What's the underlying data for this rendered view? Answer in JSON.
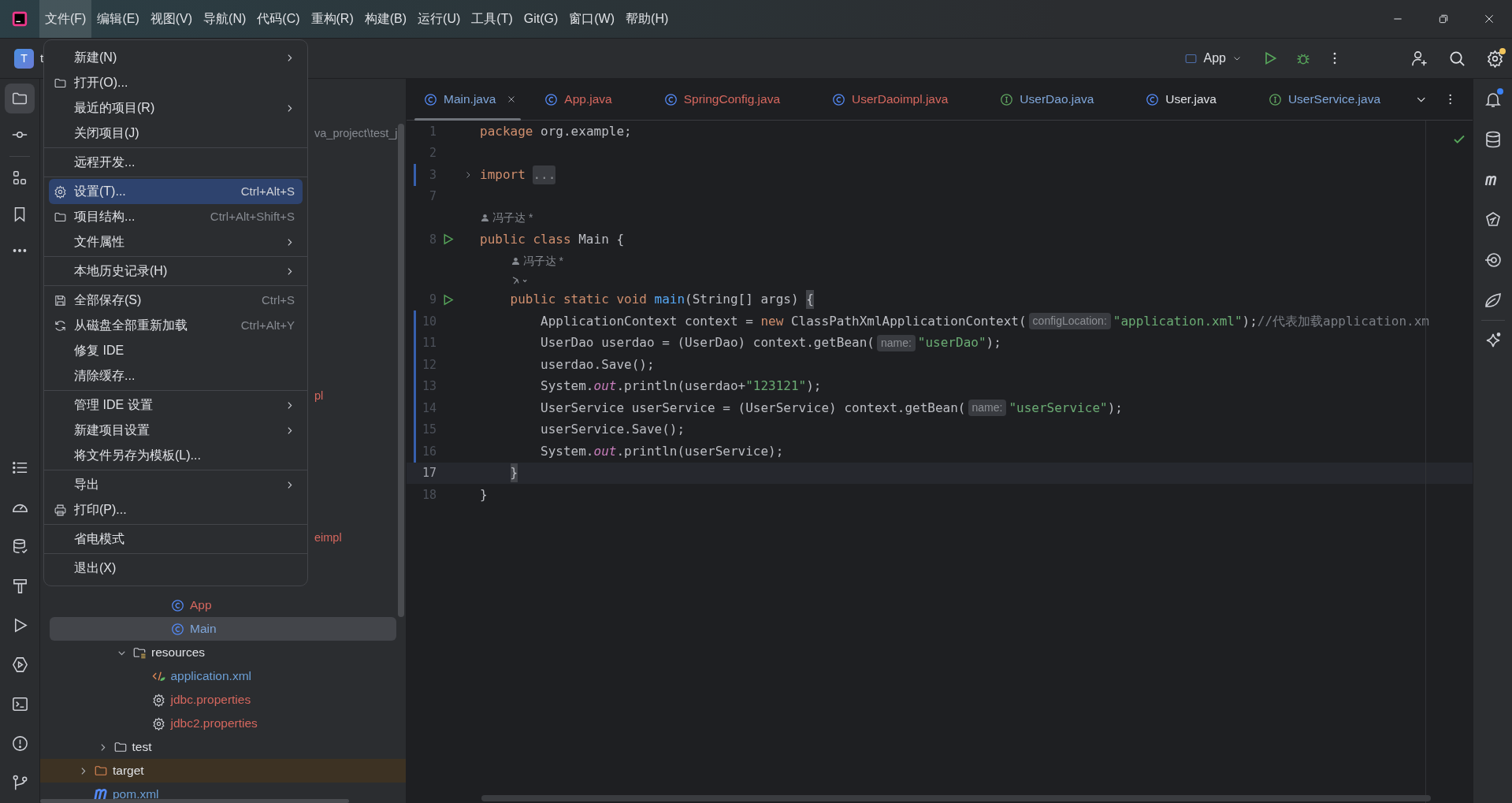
{
  "menu_bar": [
    {
      "label": "文件(F)",
      "selected": true
    },
    {
      "label": "编辑(E)",
      "selected": false
    },
    {
      "label": "视图(V)",
      "selected": false
    },
    {
      "label": "导航(N)",
      "selected": false
    },
    {
      "label": "代码(C)",
      "selected": false
    },
    {
      "label": "重构(R)",
      "selected": false
    },
    {
      "label": "构建(B)",
      "selected": false
    },
    {
      "label": "运行(U)",
      "selected": false
    },
    {
      "label": "工具(T)",
      "selected": false
    },
    {
      "label": "Git(G)",
      "selected": false
    },
    {
      "label": "窗口(W)",
      "selected": false
    },
    {
      "label": "帮助(H)",
      "selected": false
    }
  ],
  "toolbar": {
    "project_initial": "T",
    "project_name": "t",
    "run_config": "App",
    "settings_badge": true
  },
  "right_strip": {
    "notification_badge": true
  },
  "file_menu": {
    "sections": [
      [
        {
          "label": "新建(N)",
          "kind": "plain",
          "submenu": true,
          "selected": false
        },
        {
          "label": "打开(O)...",
          "kind": "open",
          "submenu": false,
          "selected": false
        },
        {
          "label": "最近的项目(R)",
          "kind": "plain",
          "submenu": true,
          "selected": false
        },
        {
          "label": "关闭项目(J)",
          "kind": "plain",
          "submenu": false,
          "selected": false
        }
      ],
      [
        {
          "label": "远程开发...",
          "kind": "plain",
          "submenu": false,
          "selected": false
        }
      ],
      [
        {
          "label": "设置(T)...",
          "kind": "settings",
          "shortcut": "Ctrl+Alt+S",
          "submenu": false,
          "selected": true
        },
        {
          "label": "项目结构...",
          "kind": "structure",
          "shortcut": "Ctrl+Alt+Shift+S",
          "submenu": false,
          "selected": false
        },
        {
          "label": "文件属性",
          "kind": "plain",
          "submenu": true,
          "selected": false
        }
      ],
      [
        {
          "label": "本地历史记录(H)",
          "kind": "plain",
          "submenu": true,
          "selected": false
        }
      ],
      [
        {
          "label": "全部保存(S)",
          "kind": "save",
          "shortcut": "Ctrl+S",
          "submenu": false,
          "selected": false
        },
        {
          "label": "从磁盘全部重新加载",
          "kind": "reload",
          "shortcut": "Ctrl+Alt+Y",
          "submenu": false,
          "selected": false
        },
        {
          "label": "修复 IDE",
          "kind": "plain",
          "submenu": false,
          "selected": false
        },
        {
          "label": "清除缓存...",
          "kind": "plain",
          "submenu": false,
          "selected": false
        }
      ],
      [
        {
          "label": "管理 IDE 设置",
          "kind": "plain",
          "submenu": true,
          "selected": false
        },
        {
          "label": "新建项目设置",
          "kind": "plain",
          "submenu": true,
          "selected": false
        },
        {
          "label": "将文件另存为模板(L)...",
          "kind": "plain",
          "submenu": false,
          "selected": false
        }
      ],
      [
        {
          "label": "导出",
          "kind": "plain",
          "submenu": true,
          "selected": false
        },
        {
          "label": "打印(P)...",
          "kind": "print",
          "submenu": false,
          "selected": false
        }
      ],
      [
        {
          "label": "省电模式",
          "kind": "plain",
          "submenu": false,
          "selected": false
        }
      ],
      [
        {
          "label": "退出(X)",
          "kind": "plain",
          "submenu": false,
          "selected": false
        }
      ]
    ]
  },
  "project_tree": {
    "partial_labels": [
      "va_project\\test_j",
      "pl",
      "eimpl"
    ],
    "rows": [
      {
        "kind": "covered",
        "children": [
          {
            "kind": "covered",
            "children": [
              {
                "kind": "covered",
                "children": [
                  {
                    "kind": "covered",
                    "children": [
                      {
                        "kind": "class",
                        "label": "App",
                        "color": "#d5675e",
                        "selected": false
                      },
                      {
                        "kind": "class",
                        "label": "Main",
                        "color": "#7fa6d9",
                        "selected": true
                      }
                    ]
                  }
                ]
              },
              {
                "kind": "resources",
                "label": "resources",
                "color": "#dfe1e5",
                "expanded": true,
                "selected": false,
                "children": [
                  {
                    "kind": "xml",
                    "label": "application.xml",
                    "color": "#6c9fd6",
                    "selected": false
                  },
                  {
                    "kind": "properties",
                    "label": "jdbc.properties",
                    "color": "#d5675e",
                    "selected": false
                  },
                  {
                    "kind": "properties",
                    "label": "jdbc2.properties",
                    "color": "#d5675e",
                    "selected": false
                  }
                ]
              }
            ]
          },
          {
            "kind": "folder",
            "label": "test",
            "color": "#dfe1e5",
            "expanded": false,
            "selected": false
          }
        ]
      },
      {
        "kind": "excluded",
        "label": "target",
        "color": "#dfe1e5",
        "expanded": false,
        "selected": false
      },
      {
        "kind": "maven",
        "label": "pom.xml",
        "color": "#6c9fd6",
        "selected": false
      }
    ]
  },
  "editor_tabs": [
    {
      "label": "Main.java",
      "kind": "class",
      "color": "#7fa6d9",
      "selected": true
    },
    {
      "label": "App.java",
      "kind": "class",
      "color": "#d5675e",
      "selected": false
    },
    {
      "label": "SpringConfig.java",
      "kind": "class",
      "color": "#d5675e",
      "selected": false
    },
    {
      "label": "UserDaoimpl.java",
      "kind": "class",
      "color": "#d5675e",
      "selected": false
    },
    {
      "label": "UserDao.java",
      "kind": "interface",
      "color": "#7fa6d9",
      "selected": false
    },
    {
      "label": "User.java",
      "kind": "class",
      "color": "#dfe1e5",
      "selected": false
    },
    {
      "label": "UserService.java",
      "kind": "interface",
      "color": "#7fa6d9",
      "selected": false
    }
  ],
  "code_rows": [
    {
      "number": "1",
      "tokens": [
        {
          "kind": "keyword",
          "text": "package"
        },
        {
          "kind": "plain",
          "text": " org.example;"
        }
      ]
    },
    {
      "number": "2"
    },
    {
      "number": "3",
      "changed": true,
      "foldable": true,
      "tokens": [
        {
          "kind": "keyword",
          "text": "import "
        },
        {
          "kind": "fold",
          "text": "..."
        }
      ]
    },
    {
      "number": "7"
    },
    {
      "number": "8",
      "author": "冯子达 *",
      "runnable": true,
      "tokens": [
        {
          "kind": "keyword",
          "text": "public class "
        },
        {
          "kind": "plain",
          "text": "Main {"
        }
      ]
    },
    {
      "number": "9",
      "author": "冯子达 *",
      "inlay_icon": true,
      "runnable": true,
      "tokens": [
        {
          "kind": "keyword",
          "text": "    public static void "
        },
        {
          "kind": "method",
          "text": "main"
        },
        {
          "kind": "plain",
          "text": "(String[] args) "
        },
        {
          "kind": "brace",
          "text": "{"
        }
      ]
    },
    {
      "number": "10",
      "changed": true,
      "tokens": [
        {
          "kind": "plain",
          "text": "        ApplicationContext context = "
        },
        {
          "kind": "keyword",
          "text": "new"
        },
        {
          "kind": "plain",
          "text": " ClassPathXmlApplicationContext("
        },
        {
          "kind": "hint",
          "text": "configLocation:"
        },
        {
          "kind": "string",
          "text": "\"application.xml\""
        },
        {
          "kind": "plain",
          "text": ");"
        },
        {
          "kind": "comment",
          "text": "//代表加载application.xm"
        }
      ]
    },
    {
      "number": "11",
      "changed": true,
      "tokens": [
        {
          "kind": "plain",
          "text": "        UserDao userdao = (UserDao) context.getBean("
        },
        {
          "kind": "hint",
          "text": "name:"
        },
        {
          "kind": "string",
          "text": "\"userDao\""
        },
        {
          "kind": "plain",
          "text": ");"
        }
      ]
    },
    {
      "number": "12",
      "changed": true,
      "tokens": [
        {
          "kind": "plain",
          "text": "        userdao.Save();"
        }
      ]
    },
    {
      "number": "13",
      "changed": true,
      "tokens": [
        {
          "kind": "plain",
          "text": "        System."
        },
        {
          "kind": "field",
          "text": "out"
        },
        {
          "kind": "plain",
          "text": ".println(userdao+"
        },
        {
          "kind": "string",
          "text": "\"123121\""
        },
        {
          "kind": "plain",
          "text": ");"
        }
      ]
    },
    {
      "number": "14",
      "changed": true,
      "tokens": [
        {
          "kind": "plain",
          "text": "        UserService userService = (UserService) context.getBean("
        },
        {
          "kind": "hint",
          "text": "name:"
        },
        {
          "kind": "string",
          "text": "\"userService\""
        },
        {
          "kind": "plain",
          "text": ");"
        }
      ]
    },
    {
      "number": "15",
      "changed": true,
      "tokens": [
        {
          "kind": "plain",
          "text": "        userService.Save();"
        }
      ]
    },
    {
      "number": "16",
      "changed": true,
      "tokens": [
        {
          "kind": "plain",
          "text": "        System."
        },
        {
          "kind": "field",
          "text": "out"
        },
        {
          "kind": "plain",
          "text": ".println(userService);"
        }
      ]
    },
    {
      "number": "17",
      "current": true,
      "tokens": [
        {
          "kind": "brace",
          "text": "    }"
        }
      ]
    },
    {
      "number": "18",
      "tokens": [
        {
          "kind": "plain",
          "text": "}"
        }
      ]
    }
  ]
}
